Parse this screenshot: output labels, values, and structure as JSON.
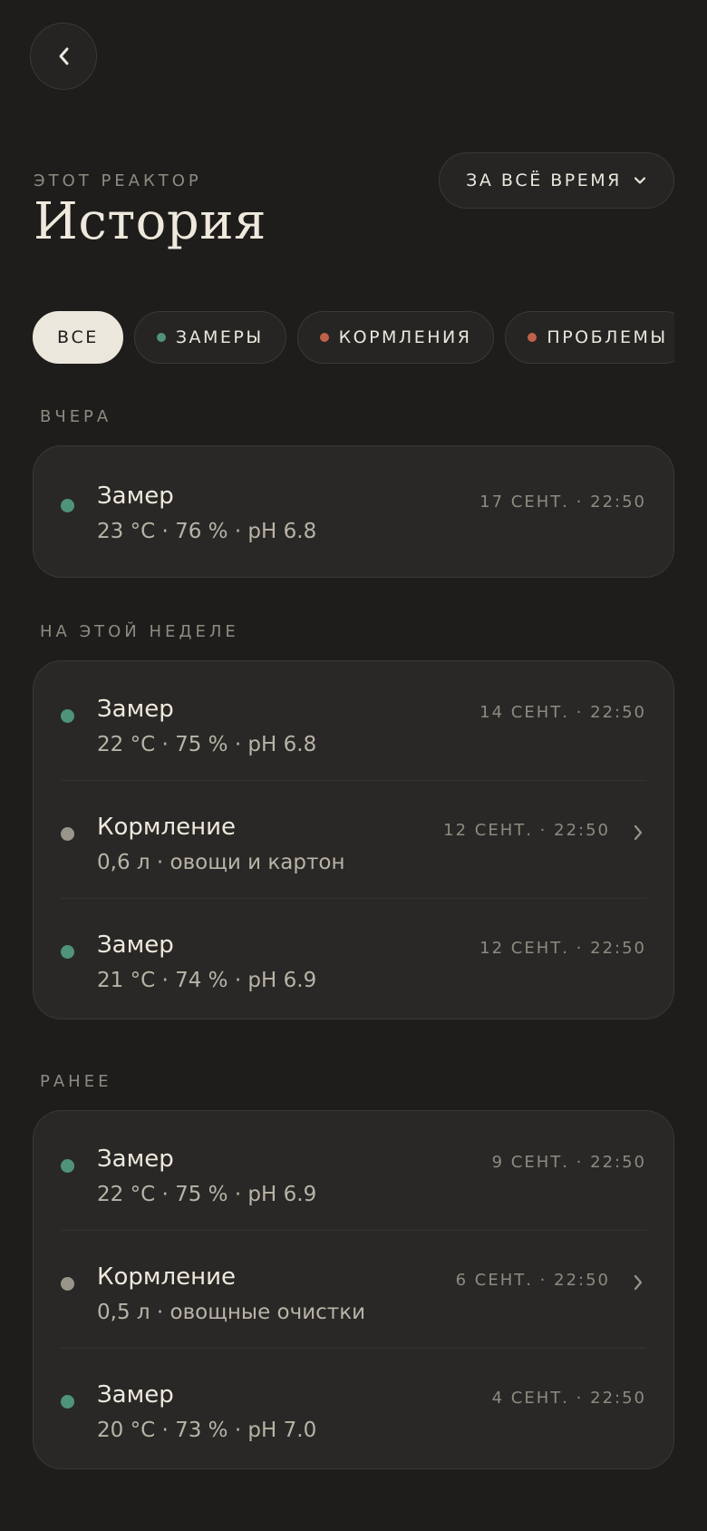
{
  "header": {
    "eyebrow": "ЭТОТ РЕАКТОР",
    "title": "История",
    "period_label": "ЗА ВСЁ ВРЕМЯ"
  },
  "filters": [
    {
      "label": "ВСЕ",
      "active": true,
      "dot_color": ""
    },
    {
      "label": "ЗАМЕРЫ",
      "active": false,
      "dot_color": "#4f9478"
    },
    {
      "label": "КОРМЛЕНИЯ",
      "active": false,
      "dot_color": "#c0624a"
    },
    {
      "label": "ПРОБЛЕМЫ",
      "active": false,
      "dot_color": "#c0624a"
    }
  ],
  "colors": {
    "measure": "#4f9478",
    "feeding": "#9a958a",
    "problem": "#c0624a"
  },
  "sections": [
    {
      "label": "ВЧЕРА",
      "items": [
        {
          "name": "Замер",
          "detail": "23 °C · 76 % · pH 6.8",
          "time": "17 СЕНТ. · 22:50",
          "kind": "measure"
        }
      ]
    },
    {
      "label": "НА ЭТОЙ НЕДЕЛЕ",
      "items": [
        {
          "name": "Замер",
          "detail": "22 °C · 75 % · pH 6.8",
          "time": "14 СЕНТ. · 22:50",
          "kind": "measure"
        },
        {
          "name": "Кормление",
          "detail": "0,6 л · овощи и картон",
          "time": "12 СЕНТ. · 22:50",
          "kind": "feeding"
        },
        {
          "name": "Замер",
          "detail": "21 °C · 74 % · pH 6.9",
          "time": "12 СЕНТ. · 22:50",
          "kind": "measure"
        }
      ]
    },
    {
      "label": "РАНЕЕ",
      "items": [
        {
          "name": "Замер",
          "detail": "22 °C · 75 % · pH 6.9",
          "time": "9 СЕНТ. · 22:50",
          "kind": "measure"
        },
        {
          "name": "Кормление",
          "detail": "0,5 л · овощные очистки",
          "time": "6 СЕНТ. · 22:50",
          "kind": "feeding"
        },
        {
          "name": "Замер",
          "detail": "20 °C · 73 % · pH 7.0",
          "time": "4 СЕНТ. · 22:50",
          "kind": "measure"
        }
      ]
    }
  ]
}
